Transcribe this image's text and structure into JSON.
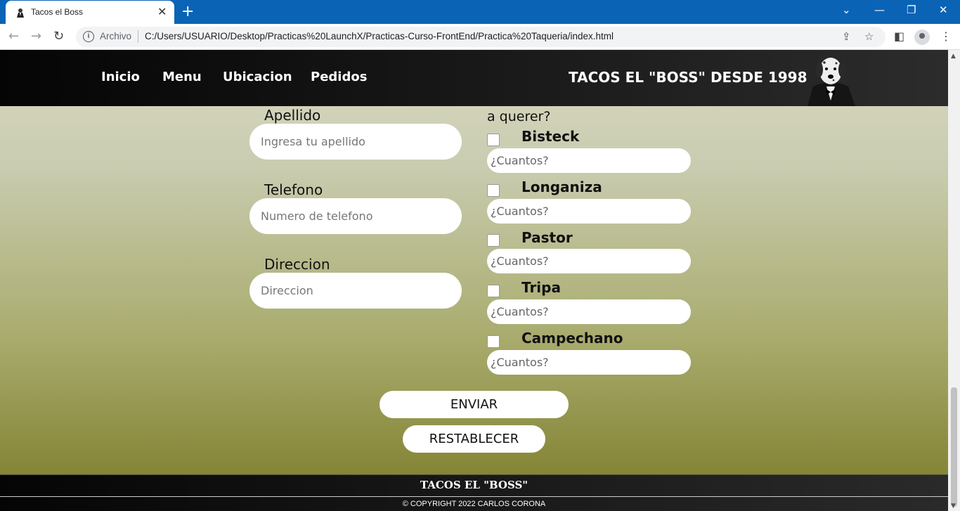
{
  "browser": {
    "tab_title": "Tacos el Boss",
    "tab_close": "✕",
    "new_tab": "+",
    "origin_label": "Archivo",
    "url": "C:/Users/USUARIO/Desktop/Practicas%20LaunchX/Practicas-Curso-FrontEnd/Practica%20Taqueria/index.html",
    "window_controls": {
      "minimize": "—",
      "restore": "❐",
      "close": "✕",
      "tab_search": "⌄"
    }
  },
  "header": {
    "nav": [
      "Inicio",
      "Menu",
      "Ubicacion",
      "Pedidos"
    ],
    "brand": "TACOS EL \"BOSS\" DESDE 1998"
  },
  "form": {
    "fields": [
      {
        "label": "Apellido",
        "placeholder": "Ingresa tu apellido"
      },
      {
        "label": "Telefono",
        "placeholder": "Numero de telefono"
      },
      {
        "label": "Direccion",
        "placeholder": "Direccion"
      }
    ],
    "question_line": "a querer?",
    "tacos": [
      {
        "label": "Bisteck",
        "placeholder": "¿Cuantos?"
      },
      {
        "label": "Longaniza",
        "placeholder": "¿Cuantos?"
      },
      {
        "label": "Pastor",
        "placeholder": "¿Cuantos?"
      },
      {
        "label": "Tripa",
        "placeholder": "¿Cuantos?"
      },
      {
        "label": "Campechano",
        "placeholder": "¿Cuantos?"
      }
    ],
    "submit_label": "ENVIAR",
    "reset_label": "RESTABLECER"
  },
  "footer": {
    "title": "TACOS EL \"BOSS\"",
    "copyright": "© COPYRIGHT 2022 CARLOS CORONA"
  },
  "colors": {
    "chrome_blue": "#0b63b5",
    "header_bg": "#111111",
    "gradient_top": "#dad9c2",
    "gradient_bottom": "#7b7d2f"
  }
}
